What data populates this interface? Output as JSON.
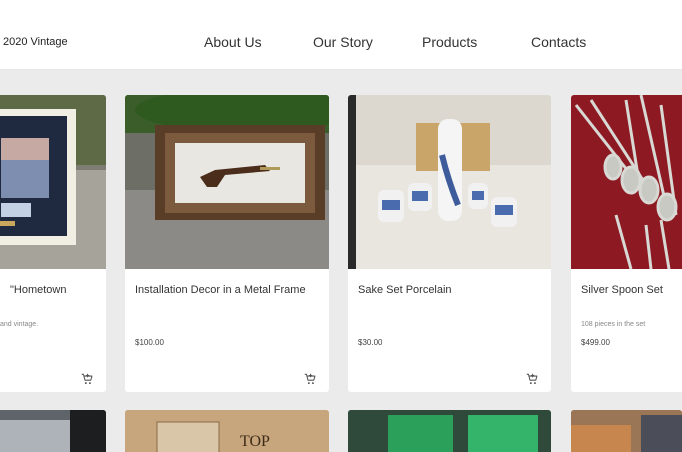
{
  "header": {
    "brand": "2020 Vintage",
    "nav": [
      "About Us",
      "Our Story",
      "Products",
      "Contacts"
    ]
  },
  "products": [
    {
      "title": "\"Hometown",
      "description": "and vintage.",
      "price": "",
      "icon": "add-to-cart-icon"
    },
    {
      "title": "Installation Decor in a Metal Frame",
      "description": "",
      "price": "$100.00",
      "icon": "add-to-cart-icon"
    },
    {
      "title": "Sake Set Porcelain",
      "description": "",
      "price": "$30.00",
      "icon": "add-to-cart-icon"
    },
    {
      "title": "Silver Spoon Set",
      "description": "108 pieces in the set",
      "price": "$499.00",
      "icon": "add-to-cart-icon"
    }
  ],
  "colors": {
    "background": "#ebebeb",
    "header": "#ffffff",
    "card": "#ffffff",
    "text": "#333333"
  }
}
